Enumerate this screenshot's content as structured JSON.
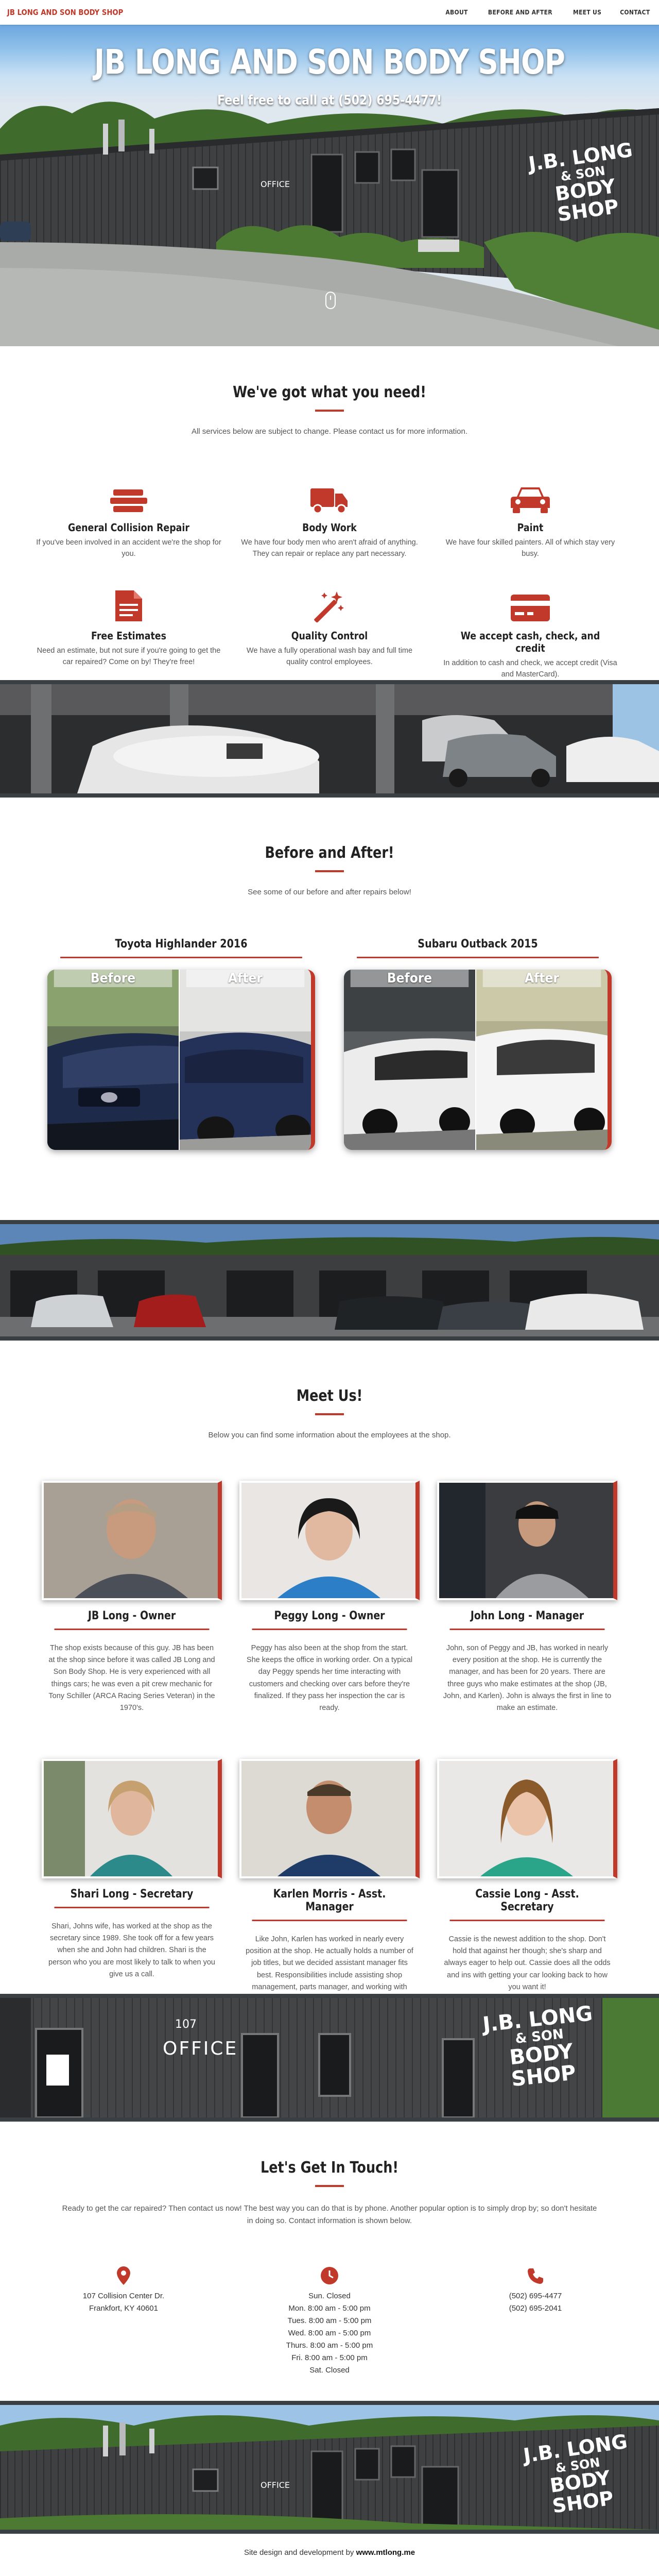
{
  "nav": {
    "brand": "JB LONG AND SON BODY SHOP",
    "items": [
      "ABOUT",
      "BEFORE AND AFTER",
      "MEET US",
      "CONTACT"
    ]
  },
  "hero": {
    "title": "JB LONG AND SON BODY SHOP",
    "subtitle": "Feel free to call at (502) 695-4477!",
    "sign": [
      "J.B. LONG",
      "& SON",
      "BODY SHOP"
    ],
    "office": "OFFICE"
  },
  "about": {
    "heading": "We've got what you need!",
    "intro": "All services below are subject to change. Please contact us for more information.",
    "services": [
      {
        "icon": "stack-icon",
        "title": "General Collision Repair",
        "text": "If you've been involved in an accident we're the shop for you."
      },
      {
        "icon": "truck-icon",
        "title": "Body Work",
        "text": "We have four body men who aren't afraid of anything. They can repair or replace any part necessary."
      },
      {
        "icon": "car-icon",
        "title": "Paint",
        "text": "We have four skilled painters. All of which stay very busy."
      },
      {
        "icon": "document-icon",
        "title": "Free Estimates",
        "text": "Need an estimate, but not sure if you're going to get the car repaired? Come on by! They're free!"
      },
      {
        "icon": "magic-wand-icon",
        "title": "Quality Control",
        "text": "We have a fully operational wash bay and full time quality control employees."
      },
      {
        "icon": "credit-card-icon",
        "title": "We accept cash, check, and credit",
        "text": "In addition to cash and check, we accept credit (Visa and MasterCard)."
      }
    ]
  },
  "before_after": {
    "heading": "Before and After!",
    "intro": "See some of our before and after repairs below!",
    "before_label": "Before",
    "after_label": "After",
    "cars": [
      {
        "title": "Toyota Highlander 2016"
      },
      {
        "title": "Subaru Outback 2015"
      }
    ]
  },
  "meet": {
    "heading": "Meet Us!",
    "intro": "Below you can find some information about the employees at the shop.",
    "members": [
      {
        "name": "JB Long - Owner",
        "bio": "The shop exists because of this guy. JB has been at the shop since before it was called JB Long and Son Body Shop. He is very experienced with all things cars; he was even a pit crew mechanic for Tony Schiller (ARCA Racing Series Veteran) in the 1970's."
      },
      {
        "name": "Peggy Long - Owner",
        "bio": "Peggy has also been at the shop from the start. She keeps the office in working order. On a typical day Peggy spends her time interacting with customers and checking over cars before they're finalized. If they pass her inspection the car is ready."
      },
      {
        "name": "John Long - Manager",
        "bio": "John, son of Peggy and JB, has worked in nearly every position at the shop. He is currently the manager, and has been for 20 years. There are three guys who make estimates at the shop (JB, John, and Karlen). John is always the first in line to make an estimate."
      },
      {
        "name": "Shari Long - Secretary",
        "bio": "Shari, Johns wife, has worked at the shop as the secretary since 1989. She took off for a few years when she and John had children. Shari is the person who you are most likely to talk to when you give us a call."
      },
      {
        "name": "Karlen Morris - Asst. Manager",
        "bio": "Like John, Karlen has worked in nearly every position at the shop. He actually holds a number of job titles, but we decided assistant manager fits best. Responsibilities include assisting shop management, parts manager, and working with insurance adjusters."
      },
      {
        "name": "Cassie Long - Asst. Secretary",
        "bio": "Cassie is the newest addition to the shop. Don't hold that against her though; she's sharp and always eager to help out. Cassie does all the odds and ins with getting your car looking back to how you want it!"
      }
    ]
  },
  "office_banner": {
    "sign": [
      "J.B. LONG",
      "& SON",
      "BODY SHOP"
    ],
    "office": "OFFICE",
    "number": "107"
  },
  "contact": {
    "heading": "Let's Get In Touch!",
    "intro": "Ready to get the car repaired? Then contact us now! The best way you can do that is by phone. Another popular option is to simply drop by; so don't hesitate in doing so. Contact information is shown below.",
    "address": [
      "107 Collision Center Dr.",
      "Frankfort, KY 40601"
    ],
    "hours": [
      "Sun. Closed",
      "Mon. 8:00 am - 5:00 pm",
      "Tues. 8:00 am - 5:00 pm",
      "Wed. 8:00 am - 5:00 pm",
      "Thurs. 8:00 am - 5:00 pm",
      "Fri. 8:00 am - 5:00 pm",
      "Sat. Closed"
    ],
    "phones": [
      "(502) 695-4477",
      "(502) 695-2041"
    ]
  },
  "footer": {
    "text": "Site design and development by",
    "link": "www.mtlong.me"
  },
  "colors": {
    "accent": "#c0392b",
    "heading": "#222222",
    "body": "#555555"
  }
}
